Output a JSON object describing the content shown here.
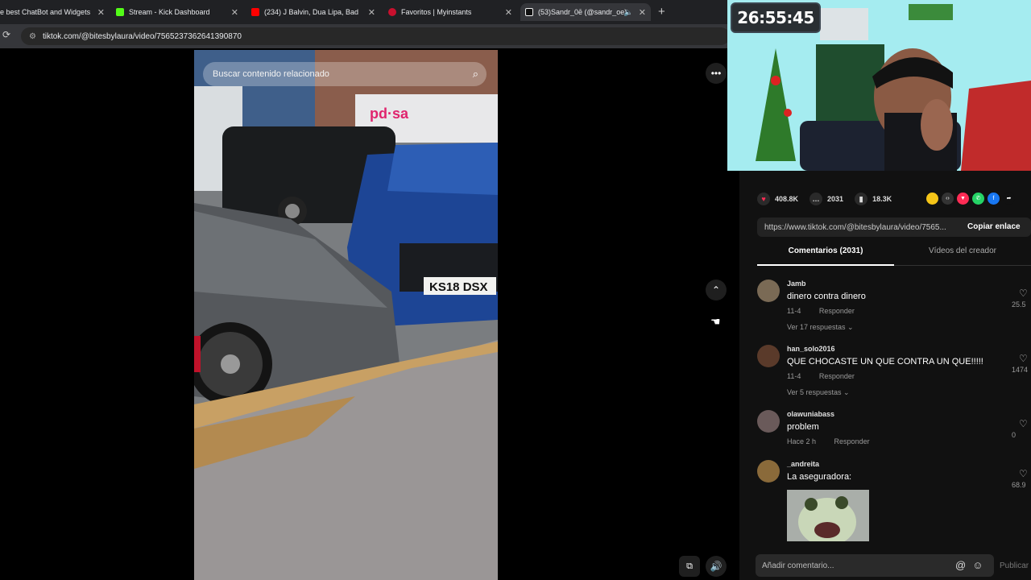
{
  "browser": {
    "tabs": [
      {
        "title": "e best ChatBot and Widgets",
        "favicon": "bot-favicon",
        "color": "#9aa0a6"
      },
      {
        "title": "Stream - Kick Dashboard",
        "favicon": "kick-favicon",
        "color": "#53fc18"
      },
      {
        "title": "(234) J Balvin, Dua Lipa, Bad Bunny",
        "favicon": "youtube-favicon",
        "color": "#ff0000"
      },
      {
        "title": "Favoritos | Myinstants",
        "favicon": "myinstants-favicon",
        "color": "#c8102e"
      },
      {
        "title": "(53)Sandr_0ē (@sandr_oe) | ",
        "favicon": "tiktok-favicon",
        "color": "#ffffff"
      }
    ],
    "url": "tiktok.com/@bitesbylaura/video/7565237362641390870"
  },
  "video": {
    "search_placeholder": "Buscar contenido relacionado",
    "plate_text": "KS18 DSX",
    "shop_sign": "pd·sa"
  },
  "overlay": {
    "timer": "26:55:45"
  },
  "stats": {
    "likes": "408.8K",
    "comments": "2031",
    "saves": "18.3K"
  },
  "link": {
    "url": "https://www.tiktok.com/@bitesbylaura/video/7565...",
    "copy_label": "Copiar enlace"
  },
  "panel_tabs": {
    "comments": "Comentarios (2031)",
    "creator_videos": "Vídeos del creador"
  },
  "comments": [
    {
      "user": "Jamb",
      "text": "dinero contra dinero",
      "date": "11-4",
      "reply": "Responder",
      "replies": "Ver 17 respuestas",
      "likes": "25.5"
    },
    {
      "user": "han_solo2016",
      "text": "QUE CHOCASTE UN QUE CONTRA UN QUE!!!!!",
      "date": "11-4",
      "reply": "Responder",
      "replies": "Ver 5 respuestas",
      "likes": "1474"
    },
    {
      "user": "olawuniabass",
      "text": "problem",
      "date": "Hace 2 h",
      "reply": "Responder",
      "replies": "",
      "likes": "0"
    },
    {
      "user": "_andreita",
      "text": "La aseguradora:",
      "date": "",
      "reply": "",
      "replies": "",
      "likes": "68.9"
    }
  ],
  "composer": {
    "placeholder": "Añadir comentario...",
    "publish": "Publicar"
  }
}
